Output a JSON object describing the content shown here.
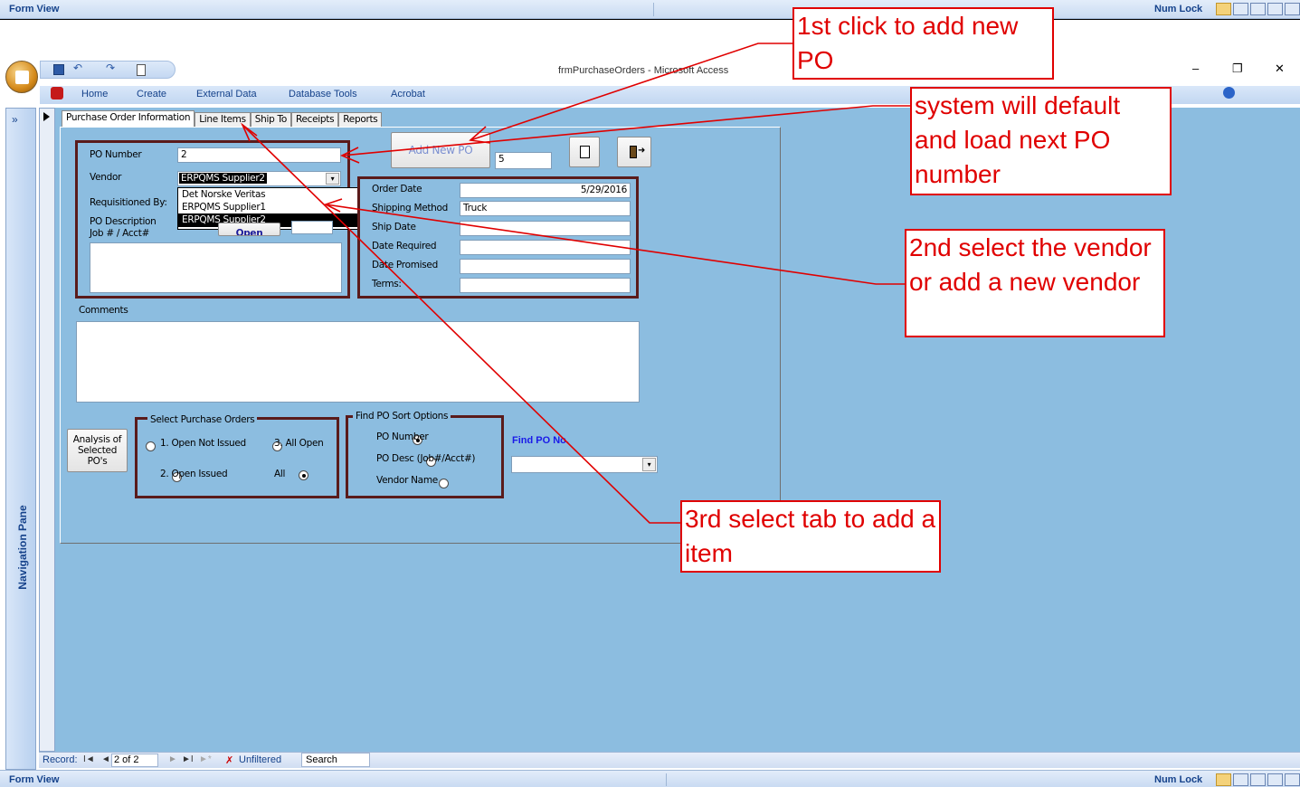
{
  "status_top": {
    "left": "Form View",
    "right": "Num Lock"
  },
  "status_bottom": {
    "left": "Form View",
    "right": "Num Lock"
  },
  "window": {
    "title": "frmPurchaseOrders - Microsoft Access",
    "minimize": "–",
    "restore": "❐",
    "close": "✕"
  },
  "ribbon": {
    "tabs": [
      "Home",
      "Create",
      "External Data",
      "Database Tools",
      "Acrobat"
    ]
  },
  "nav_pane": {
    "label": "Navigation Pane",
    "toggle": "»"
  },
  "form_tabs": [
    "Purchase Order Information",
    "Line Items",
    "Ship To",
    "Receipts",
    "Reports"
  ],
  "po": {
    "number_label": "PO Number",
    "number_value": "2",
    "vendor_label": "Vendor",
    "vendor_value": "ERPQMS Supplier2",
    "vendor_options": [
      "Det Norske Veritas",
      "ERPQMS Supplier1",
      "ERPQMS Supplier2"
    ],
    "requisitioned_label": "Requisitioned By:",
    "desc_label_1": "PO Description",
    "desc_label_2": "Job # / Acct#",
    "open_label": "Open"
  },
  "add_new_po": {
    "label": "Add New PO",
    "counter": "5"
  },
  "order": {
    "order_date_label": "Order Date",
    "order_date_value": "5/29/2016",
    "shipping_label": "Shipping Method",
    "shipping_value": "Truck",
    "ship_date_label": "Ship Date",
    "date_required_label": "Date Required",
    "date_promised_label": "Date Promised",
    "terms_label": "Terms:"
  },
  "comments_label": "Comments",
  "analysis_button": {
    "line1": "Analysis of",
    "line2": "Selected",
    "line3": "PO's"
  },
  "select_po": {
    "title": "Select Purchase Orders",
    "opt1": "1. Open Not Issued",
    "opt2": "2. Open Issued",
    "opt3": "3. All Open",
    "opt4": "All",
    "selected": "All"
  },
  "sort": {
    "title": "Find PO Sort Options",
    "opt1": "PO Number",
    "opt2": "PO Desc (Job#/Acct#)",
    "opt3": "Vendor Name",
    "selected": "PO Number"
  },
  "find_po_label": "Find PO No.",
  "record_nav": {
    "label": "Record:",
    "first": "I◄",
    "prev": "◄",
    "current": "2 of 2",
    "next": "►",
    "last": "►I",
    "new": "►*",
    "filter": "Unfiltered",
    "search": "Search"
  },
  "callouts": {
    "c1": "1st click to add new PO",
    "c2": "system will default and load next PO number",
    "c3": "2nd select the vendor or add a new vendor",
    "c4": "3rd select tab to add a item"
  },
  "colors": {
    "form_bg": "#8cbde0",
    "detail_bg": "#76a9d2",
    "callout": "#e00000",
    "box": "#5a1b1b"
  }
}
